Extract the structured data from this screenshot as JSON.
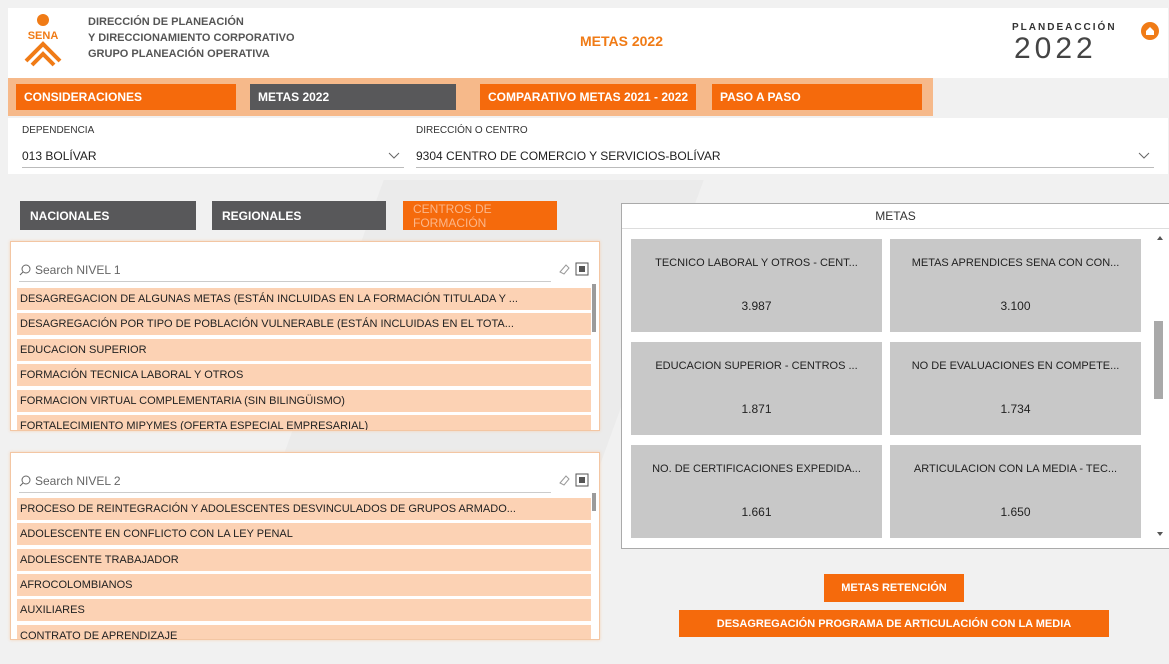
{
  "header": {
    "org_lines": [
      "DIRECCIÓN DE PLANEACIÓN",
      "Y DIRECCIONAMIENTO CORPORATIVO",
      "GRUPO PLANEACIÓN OPERATIVA"
    ],
    "logo_text": "SENA",
    "page_title": "METAS 2022",
    "plan_logo_top": "PLANDEACCIÓN",
    "plan_logo_bottom": "2022"
  },
  "nav": {
    "items": [
      {
        "label": "CONSIDERACIONES",
        "active": true
      },
      {
        "label": "METAS 2022",
        "active": false
      },
      {
        "label": "COMPARATIVO METAS 2021 - 2022",
        "active": true
      },
      {
        "label": "PASO A PASO",
        "active": true
      }
    ]
  },
  "filters": {
    "dependencia": {
      "label": "DEPENDENCIA",
      "value": "013 BOLÍVAR"
    },
    "centro": {
      "label": "DIRECCIÓN O CENTRO",
      "value": "9304 CENTRO DE COMERCIO Y SERVICIOS-BOLÍVAR"
    }
  },
  "tabs": [
    {
      "label": "NACIONALES",
      "selected": false
    },
    {
      "label": "REGIONALES",
      "selected": false
    },
    {
      "label": "CENTROS DE FORMACIÓN",
      "selected": true
    }
  ],
  "nivel1": {
    "placeholder": "Search NIVEL 1",
    "items": [
      "DESAGREGACION DE ALGUNAS METAS (ESTÁN INCLUIDAS EN LA FORMACIÓN TITULADA Y ...",
      "DESAGREGACIÓN POR TIPO DE POBLACIÓN VULNERABLE (ESTÁN INCLUIDAS EN EL TOTA...",
      "EDUCACION SUPERIOR",
      "FORMACIÓN TECNICA LABORAL Y OTROS",
      "FORMACION VIRTUAL COMPLEMENTARIA (SIN BILINGÜISMO)",
      "FORTALECIMIENTO MIPYMES (OFERTA ESPECIAL EMPRESARIAL)"
    ]
  },
  "nivel2": {
    "placeholder": "Search NIVEL 2",
    "items": [
      "PROCESO DE REINTEGRACIÓN Y ADOLESCENTES DESVINCULADOS DE GRUPOS ARMADO...",
      "ADOLESCENTE EN CONFLICTO CON LA LEY PENAL",
      "ADOLESCENTE TRABAJADOR",
      "AFROCOLOMBIANOS",
      "AUXILIARES",
      "CONTRATO DE APRENDIZAJE"
    ]
  },
  "metas": {
    "title": "METAS",
    "cards": [
      {
        "label": "TECNICO LABORAL Y OTROS - CENT...",
        "value": "3.987"
      },
      {
        "label": "METAS APRENDICES SENA CON CON...",
        "value": "3.100"
      },
      {
        "label": "EDUCACION SUPERIOR - CENTROS ...",
        "value": "1.871"
      },
      {
        "label": "NO DE EVALUACIONES EN COMPETE...",
        "value": "1.734"
      },
      {
        "label": "NO. DE CERTIFICACIONES EXPEDIDA...",
        "value": "1.661"
      },
      {
        "label": "ARTICULACION CON LA MEDIA - TEC...",
        "value": "1.650"
      }
    ]
  },
  "buttons": {
    "retencion": "METAS RETENCIÓN",
    "articulacion": "DESAGREGACIÓN PROGRAMA DE ARTICULACIÓN CON LA MEDIA"
  },
  "colors": {
    "accent": "#f07b16",
    "nav_dark": "#58585a",
    "item_bg": "#fcd2b4",
    "card_bg": "#c8c8c8"
  }
}
